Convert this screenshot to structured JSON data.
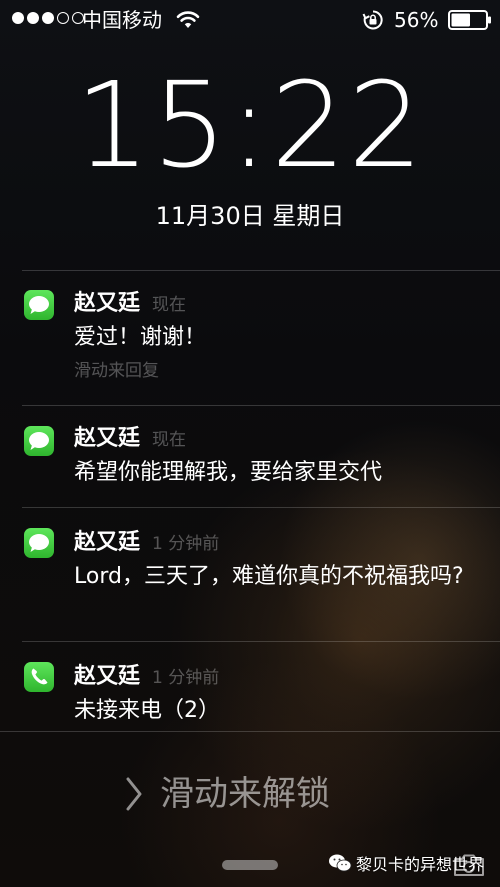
{
  "status_bar": {
    "carrier": "中国移动",
    "signal": {
      "filled": 3,
      "total": 5
    },
    "battery_percent": "56%",
    "battery_level": 0.56,
    "icons": [
      "wifi-icon",
      "rotation-lock-icon",
      "battery-icon"
    ]
  },
  "lock_screen": {
    "time": "15:22",
    "date": "11月30日 星期日"
  },
  "notifications": [
    {
      "app_icon": "messages-icon",
      "sender": "赵又廷",
      "time": "现在",
      "message": "爱过！谢谢！",
      "hint": "滑动来回复"
    },
    {
      "app_icon": "messages-icon",
      "sender": "赵又廷",
      "time": "现在",
      "message": "希望你能理解我，要给家里交代"
    },
    {
      "app_icon": "messages-icon",
      "sender": "赵又廷",
      "time": "1 分钟前",
      "message": "Lord，三天了，难道你真的不祝福我吗?"
    },
    {
      "app_icon": "phone-icon",
      "sender": "赵又廷",
      "time": "1 分钟前",
      "message": "未接来电（2）"
    }
  ],
  "unlock": {
    "label": "滑动来解锁",
    "icon": "chevron-right-icon"
  },
  "watermark": {
    "text": "黎贝卡的异想世界",
    "icon": "wechat-icon"
  },
  "camera_icon": "camera-icon",
  "colors": {
    "messages_green": "#3fcf3c",
    "background": "#0b0b0d"
  }
}
